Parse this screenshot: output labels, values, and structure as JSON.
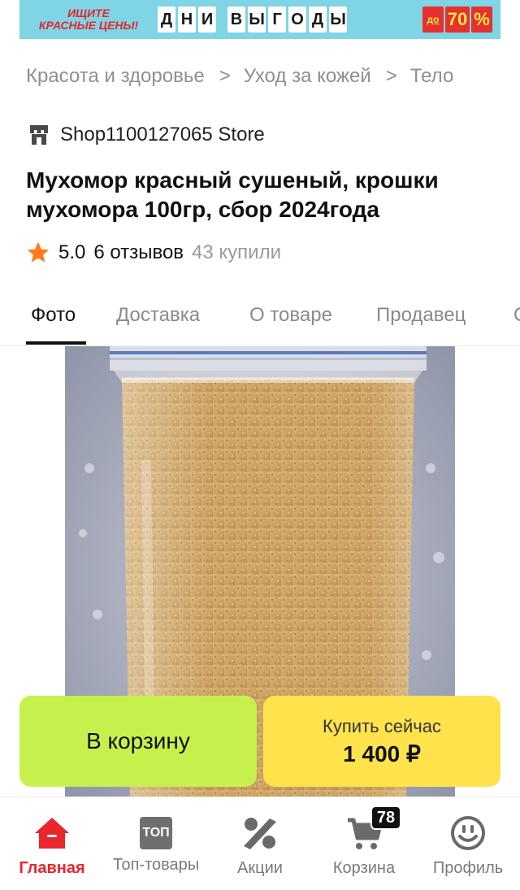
{
  "promo": {
    "left_line1": "ИЩИТЕ",
    "left_line2": "КРАСНЫЕ ЦЕНЫ!",
    "letters": [
      "Д",
      "Н",
      "И",
      "",
      "В",
      "Ы",
      "Г",
      "О",
      "Д",
      "Ы"
    ],
    "discount_prefix": "до",
    "discount_value": "70",
    "discount_sign": "%"
  },
  "breadcrumb": {
    "items": [
      "Красота и здоровье",
      "Уход за кожей",
      "Тело"
    ],
    "separator": ">"
  },
  "store": {
    "name": "Shop1100127065 Store"
  },
  "product": {
    "title": "Мухомор красный сушеный, крошки мухомора 100гр, сбор 2024года",
    "rating": "5.0",
    "reviews": "6 отзывов",
    "bought": "43 купили"
  },
  "tabs": [
    "Фото",
    "Доставка",
    "О товаре",
    "Продавец",
    "С"
  ],
  "actions": {
    "cart_label": "В корзину",
    "buy_label": "Купить сейчас",
    "price": "1 400 ₽"
  },
  "bottom_nav": {
    "items": [
      {
        "label": "Главная",
        "icon": "home-icon",
        "active": true
      },
      {
        "label": "Топ-товары",
        "icon": "top-icon",
        "icon_text": "ТОП"
      },
      {
        "label": "Акции",
        "icon": "percent-icon"
      },
      {
        "label": "Корзина",
        "icon": "cart-icon",
        "badge": "78"
      },
      {
        "label": "Профиль",
        "icon": "profile-icon"
      }
    ]
  },
  "colors": {
    "accent_red": "#e8262e",
    "cart_button": "#c6f14c",
    "buy_button": "#ffe24c",
    "promo_bg": "#7fd4e6",
    "star": "#ff7a1a"
  }
}
